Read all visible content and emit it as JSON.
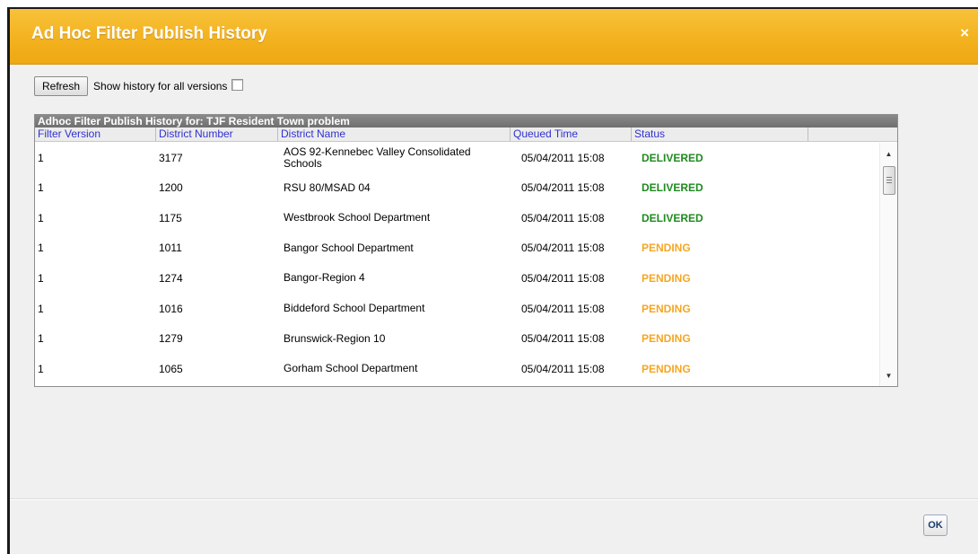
{
  "dialog": {
    "title": "Ad Hoc Filter Publish History",
    "close_label": "×",
    "ok_label": "OK"
  },
  "toolbar": {
    "refresh_label": "Refresh",
    "show_all_label": "Show history for all versions",
    "show_all_checked": false
  },
  "grid": {
    "caption": "Adhoc Filter Publish History for: TJF Resident Town problem",
    "columns": [
      "Filter Version",
      "District Number",
      "District Name",
      "Queued Time",
      "Status"
    ],
    "rows": [
      {
        "version": "1",
        "district_number": "3177",
        "district_name": "AOS 92-Kennebec Valley Consolidated Schools",
        "queued_time": "05/04/2011 15:08",
        "status": "DELIVERED"
      },
      {
        "version": "1",
        "district_number": "1200",
        "district_name": "RSU 80/MSAD 04",
        "queued_time": "05/04/2011 15:08",
        "status": "DELIVERED"
      },
      {
        "version": "1",
        "district_number": "1175",
        "district_name": "Westbrook School Department",
        "queued_time": "05/04/2011 15:08",
        "status": "DELIVERED"
      },
      {
        "version": "1",
        "district_number": "1011",
        "district_name": "Bangor School Department",
        "queued_time": "05/04/2011 15:08",
        "status": "PENDING"
      },
      {
        "version": "1",
        "district_number": "1274",
        "district_name": "Bangor-Region 4",
        "queued_time": "05/04/2011 15:08",
        "status": "PENDING"
      },
      {
        "version": "1",
        "district_number": "1016",
        "district_name": "Biddeford School Department",
        "queued_time": "05/04/2011 15:08",
        "status": "PENDING"
      },
      {
        "version": "1",
        "district_number": "1279",
        "district_name": "Brunswick-Region 10",
        "queued_time": "05/04/2011 15:08",
        "status": "PENDING"
      },
      {
        "version": "1",
        "district_number": "1065",
        "district_name": "Gorham School Department",
        "queued_time": "05/04/2011 15:08",
        "status": "PENDING"
      }
    ]
  },
  "colors": {
    "title_bar": "#f3b21f",
    "status_delivered": "#1f8a1f",
    "status_pending": "#f5a623",
    "header_text": "#3030d0"
  },
  "icons": {
    "close": "close-icon",
    "scroll_up": "scroll-up-arrow-icon",
    "scroll_down": "scroll-down-arrow-icon"
  }
}
